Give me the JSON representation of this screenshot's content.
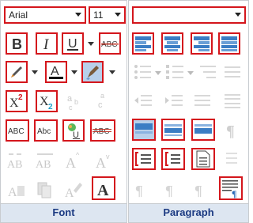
{
  "font_group": {
    "label": "Font",
    "font_family": "Arial",
    "font_size": "11",
    "buttons": [
      "bold",
      "italic",
      "underline",
      "strikethrough",
      "pen",
      "font-color",
      "highlighter",
      "superscript",
      "subscript",
      "ab-subscript",
      "ab-superscript",
      "small-caps",
      "all-caps",
      "text-effects",
      "double-strikethrough",
      "grow-font",
      "letter-spacing",
      "font-size-up",
      "font-size-down",
      "clear-format",
      "eraser",
      "font-dialog"
    ],
    "glyphs": {
      "bold": "B",
      "italic": "I",
      "underline": "U",
      "strike": "ABC",
      "font_color": "A",
      "super": "X",
      "super_digit": "2",
      "sub": "X",
      "sub_digit": "2",
      "ab": "a",
      "ab_sub": "b",
      "ab_sub_c": "c",
      "smallcaps": "ABC",
      "allcaps": "Abc",
      "effects_u": "U",
      "dstrike": "ABC",
      "ab_big": "AB",
      "a_up": "A",
      "a_down": "A",
      "font_dialog": "A"
    }
  },
  "paragraph_group": {
    "label": "Paragraph",
    "style_value": "",
    "pilcrow": "¶"
  },
  "colors": {
    "accent_red": "#d4161c",
    "footer_blue": "#1b3a82",
    "selected": "#b8d0ea"
  }
}
